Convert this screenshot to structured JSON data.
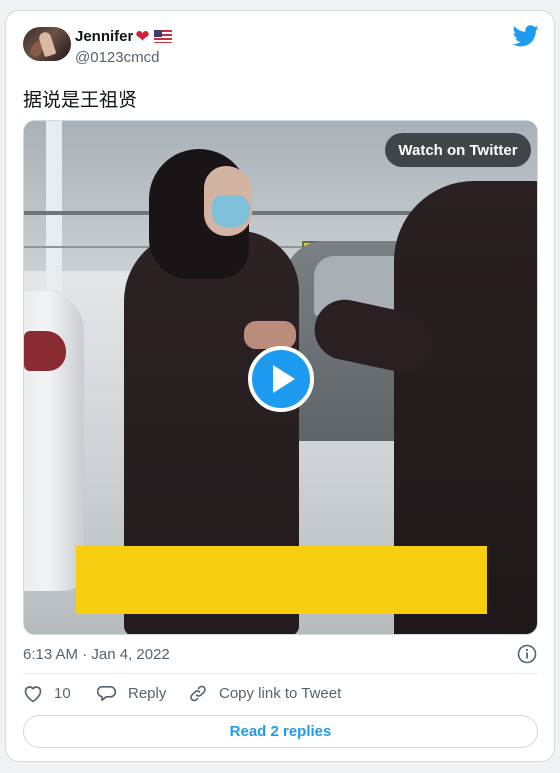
{
  "user": {
    "display_name": "Jennifer",
    "handle": "@0123cmcd"
  },
  "tweet": {
    "text": "据说是王祖贤",
    "timestamp": "6:13 AM · Jan 4, 2022"
  },
  "media": {
    "watch_label": "Watch on Twitter"
  },
  "actions": {
    "likes_count": "10",
    "reply_label": "Reply",
    "copy_label": "Copy link to Tweet",
    "read_replies_label": "Read 2 replies"
  },
  "icons": {
    "brand": "twitter-bird-icon",
    "heart": "heart-icon",
    "flag": "us-flag-icon",
    "play": "play-icon",
    "info": "info-icon",
    "like": "heart-outline-icon",
    "reply": "speech-bubble-icon",
    "copy": "link-icon"
  },
  "colors": {
    "accent": "#1d9bf0",
    "text_primary": "#0f1419",
    "text_secondary": "#536471",
    "border": "#cfd9de"
  }
}
